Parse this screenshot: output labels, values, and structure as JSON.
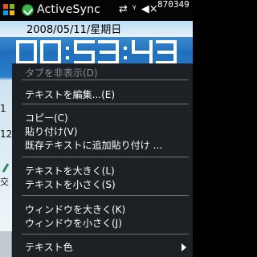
{
  "titlebar": {
    "app_title": "ActiveSync",
    "status_icons": [
      "⇄",
      "ᵞ",
      "◀×"
    ],
    "system_number": "870349"
  },
  "app": {
    "date_line": "2008/05/11/星期日",
    "clock_time": "00:53:43",
    "partial_left_text_1": "1",
    "partial_left_text_2": "12",
    "partial_left_text_3": "交"
  },
  "menu": {
    "items": [
      {
        "label": "タブを非表示(D)",
        "enabled": false
      },
      {
        "label": "テキストを編集...(E)",
        "enabled": true
      },
      {
        "label": "コピー(C)",
        "enabled": true
      },
      {
        "label": "貼り付け(V)",
        "enabled": true
      },
      {
        "label": "既存テキストに追加貼り付け ...",
        "enabled": true
      },
      {
        "label": "テキストを大きく(L)",
        "enabled": true
      },
      {
        "label": "テキストを小さく(S)",
        "enabled": true
      },
      {
        "label": "ウィンドウを大きく(K)",
        "enabled": true
      },
      {
        "label": "ウィンドウを小さく(J)",
        "enabled": true
      },
      {
        "label": "テキスト色",
        "enabled": true,
        "has_submenu": true
      }
    ]
  },
  "colors": {
    "menu_bg": "#1d2024",
    "menu_disabled_text": "#8a8d91",
    "titlebar_bg": "#050505",
    "clock_accent": "#ffffff"
  }
}
